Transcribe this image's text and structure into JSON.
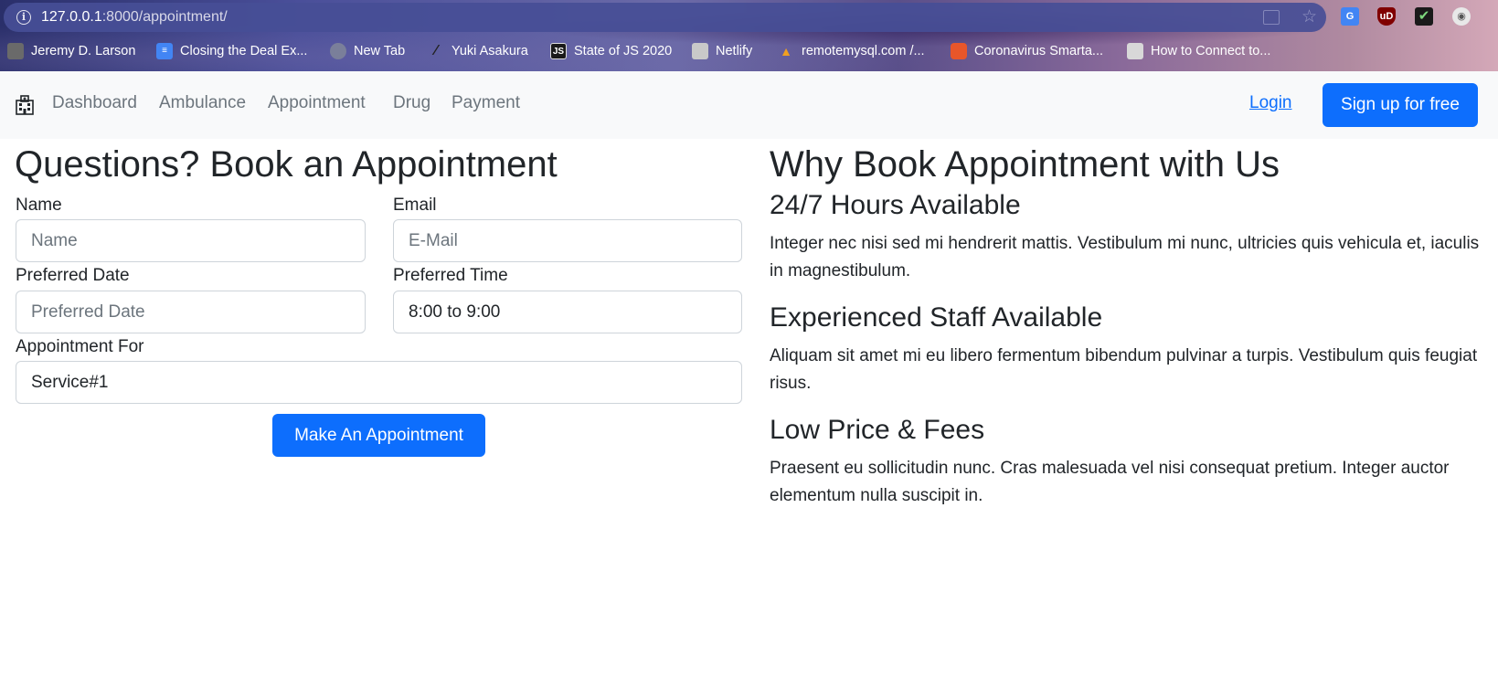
{
  "browser": {
    "url_host": "127.0.0.1",
    "url_rest": ":8000/appointment/",
    "bookmarks": [
      "Jeremy D. Larson",
      "Closing the Deal Ex...",
      "New Tab",
      "Yuki Asakura",
      "State of JS 2020",
      "Netlify",
      "remotemysql.com /...",
      "Coronavirus Smarta...",
      "How to Connect to..."
    ]
  },
  "nav": {
    "links": [
      "Dashboard",
      "Ambulance",
      "Appointment",
      "Drug",
      "Payment"
    ],
    "login": "Login",
    "signup": "Sign up for free"
  },
  "form": {
    "title": "Questions? Book an Appointment",
    "name_label": "Name",
    "name_placeholder": "Name",
    "email_label": "Email",
    "email_placeholder": "E-Mail",
    "date_label": "Preferred Date",
    "date_placeholder": "Preferred Date",
    "time_label": "Preferred Time",
    "time_value": "8:00 to 9:00",
    "service_label": "Appointment For",
    "service_value": "Service#1",
    "submit": "Make An Appointment"
  },
  "info": {
    "title": "Why Book Appointment with Us",
    "features": [
      {
        "title": "24/7 Hours Available",
        "text": "Integer nec nisi sed mi hendrerit mattis. Vestibulum mi nunc, ultricies quis vehicula et, iaculis in magnestibulum."
      },
      {
        "title": "Experienced Staff Available",
        "text": "Aliquam sit amet mi eu libero fermentum bibendum pulvinar a turpis. Vestibulum quis feugiat risus."
      },
      {
        "title": "Low Price & Fees",
        "text": "Praesent eu sollicitudin nunc. Cras malesuada vel nisi consequat pretium. Integer auctor elementum nulla suscipit in."
      }
    ]
  },
  "colors": {
    "primary": "#0d6efd",
    "navbar_bg": "#f8f9fa",
    "muted_text": "#6c757d"
  },
  "icons": [
    "info-icon",
    "share-icon",
    "star-icon",
    "translate-icon",
    "ublock-icon",
    "check-icon",
    "github-icon",
    "hospital-icon"
  ]
}
